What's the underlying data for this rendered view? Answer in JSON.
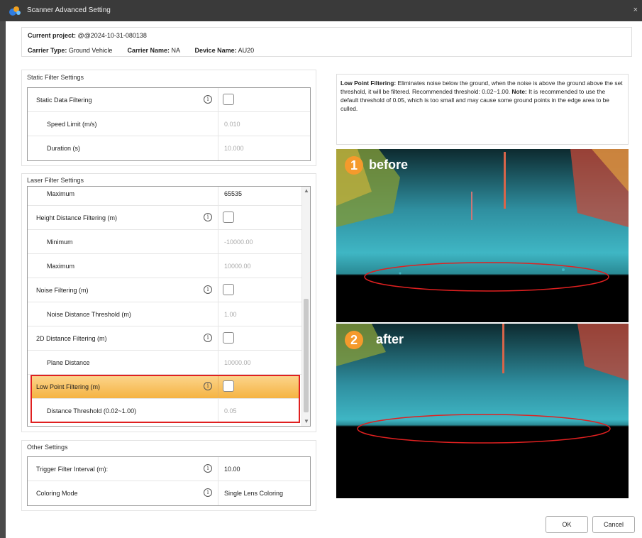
{
  "window": {
    "title": "Scanner Advanced Setting",
    "close_glyph": "×"
  },
  "header": {
    "project_label": "Current project:",
    "project_value": "@@2024-10-31-080138",
    "carrier_type_label": "Carrier Type:",
    "carrier_type_value": "Ground Vehicle",
    "carrier_name_label": "Carrier Name:",
    "carrier_name_value": "NA",
    "device_name_label": "Device Name:",
    "device_name_value": "AU20"
  },
  "static_filter": {
    "title": "Static Filter Settings",
    "rows": [
      {
        "label": "Static Data Filtering",
        "checked": false
      },
      {
        "label": "Speed Limit (m/s)",
        "value": "0.010"
      },
      {
        "label": "Duration (s)",
        "value": "10.000"
      }
    ]
  },
  "laser_filter": {
    "title": "Laser Filter Settings",
    "rows": [
      {
        "label": "Maximum",
        "value": "65535"
      },
      {
        "label": "Height Distance Filtering (m)"
      },
      {
        "label": "Minimum",
        "value": "-10000.00"
      },
      {
        "label": "Maximum",
        "value": "10000.00"
      },
      {
        "label": "Noise Filtering (m)"
      },
      {
        "label": "Noise Distance Threshold (m)",
        "value": "1.00"
      },
      {
        "label": "2D Distance Filtering (m)"
      },
      {
        "label": "Plane Distance",
        "value": "10000.00"
      },
      {
        "label": "Low Point Filtering (m)"
      },
      {
        "label": "Distance Threshold (0.02~1.00)",
        "value": "0.05"
      }
    ],
    "scroll_up": "▲",
    "scroll_down": "▼"
  },
  "other": {
    "title": "Other Settings",
    "rows": [
      {
        "label": "Trigger Filter Interval (m):",
        "value": "10.00"
      },
      {
        "label": "Coloring Mode",
        "value": "Single Lens Coloring"
      }
    ]
  },
  "description": {
    "title": "Low Point Filtering:",
    "text": " Eliminates noise below the ground, when the noise is above the ground above the set threshold, it will be filtered. Recommended threshold: 0.02~1.00.",
    "note_label": "Note:",
    "note_text": " It is recommended to use the default threshold of 0.05, which is too small and may cause some ground points in the edge area to be culled."
  },
  "images": {
    "before_num": "1",
    "before_label": "before",
    "after_num": "2",
    "after_label": "after"
  },
  "info_glyph": "i",
  "buttons": {
    "ok": "OK",
    "cancel": "Cancel"
  },
  "colors": {
    "highlight": "#f5b342",
    "red_outline": "#e02020",
    "accent_orange": "#f59a2c"
  }
}
